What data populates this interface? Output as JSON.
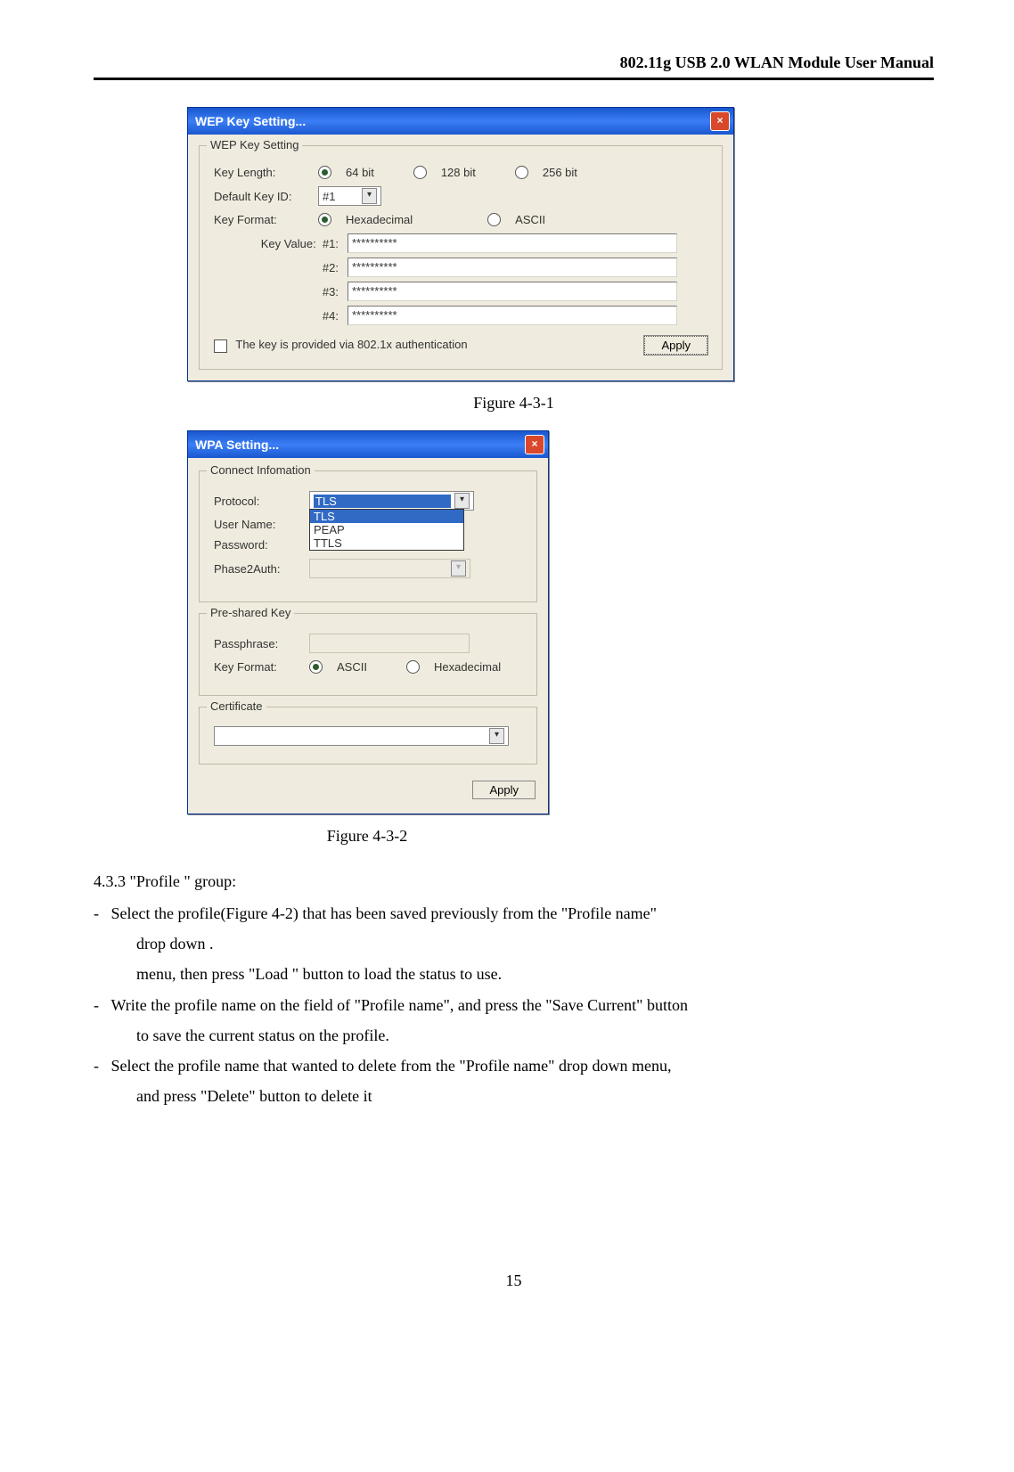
{
  "header": {
    "title": "802.11g USB 2.0 WLAN Module User Manual"
  },
  "wep": {
    "title": "WEP Key Setting...",
    "group": "WEP Key Setting",
    "key_length_label": "Key Length:",
    "opt_64": "64 bit",
    "opt_128": "128 bit",
    "opt_256": "256 bit",
    "default_key_label": "Default Key ID:",
    "default_key_value": "#1",
    "key_format_label": "Key Format:",
    "fmt_hex": "Hexadecimal",
    "fmt_ascii": "ASCII",
    "key_value_label": "Key Value:",
    "idx1": "#1:",
    "idx2": "#2:",
    "idx3": "#3:",
    "idx4": "#4:",
    "mask": "**********",
    "auth_label": "The key is provided via 802.1x authentication",
    "apply": "Apply"
  },
  "fig1": "Figure 4-3-1",
  "wpa": {
    "title": "WPA Setting...",
    "group_conn": "Connect Infomation",
    "protocol_label": "Protocol:",
    "protocol_value": "TLS",
    "dd_tls": "TLS",
    "dd_peap": "PEAP",
    "dd_ttls": "TTLS",
    "user_label": "User Name:",
    "pass_label": "Password:",
    "phase_label": "Phase2Auth:",
    "group_psk": "Pre-shared Key",
    "passphrase_label": "Passphrase:",
    "keyformat_label": "Key Format:",
    "fmt_ascii": "ASCII",
    "fmt_hex": "Hexadecimal",
    "group_cert": "Certificate",
    "apply": "Apply"
  },
  "fig2": "Figure 4-3-2",
  "section": {
    "head": "4.3.3 \"Profile \" group:",
    "line1a": "-   Select the profile(Figure 4-2) that has been saved previously from the \"Profile name\"",
    "line1b": "drop down .",
    "line2": "menu, then press \"Load \" button to load the status to use.",
    "line3a": "-   Write the profile name on the field of \"Profile name\", and press the \"Save Current\" button",
    "line3b": "to save the current status on the profile.",
    "line4a": "-   Select the profile name that wanted to delete from the \"Profile name\" drop down menu,",
    "line4b": "and press \"Delete\" button to delete it"
  },
  "footer": "15"
}
